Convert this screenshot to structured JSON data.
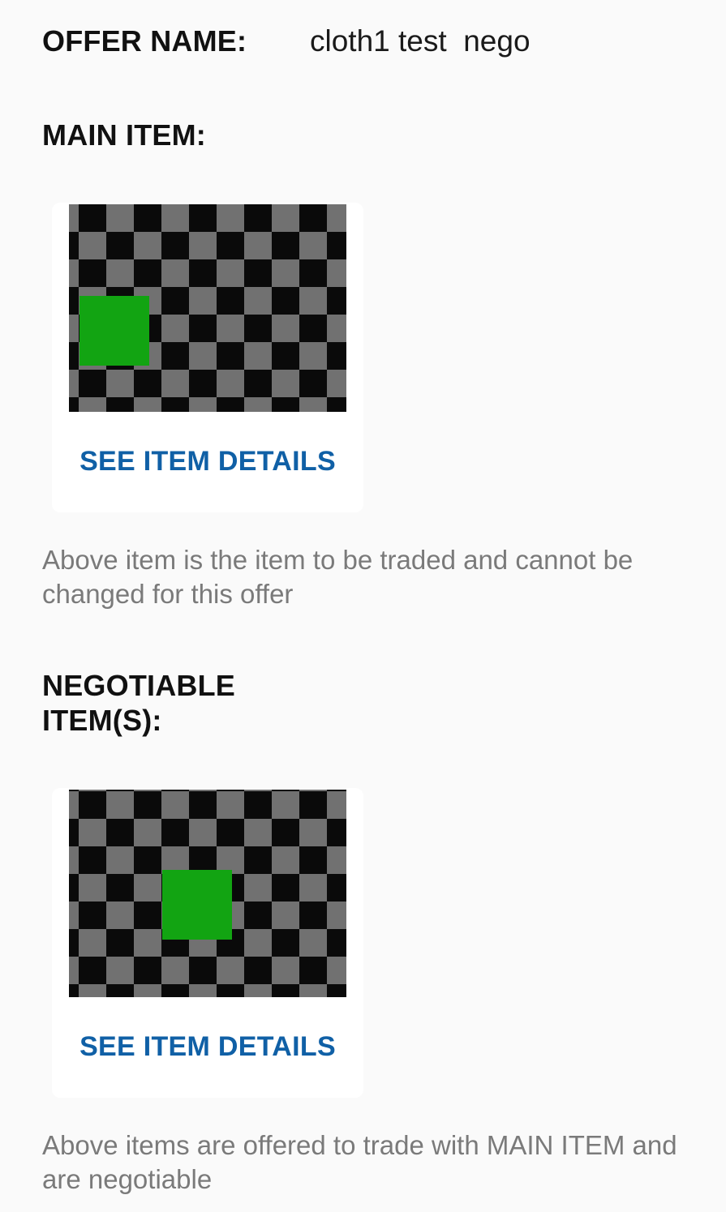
{
  "offer": {
    "name_label": "OFFER NAME:",
    "name_value": "cloth1 test  nego"
  },
  "main_item": {
    "section_label": "MAIN ITEM:",
    "details_button": "SEE ITEM DETAILS",
    "note": "Above item is the item to be traded and cannot be changed for this offer"
  },
  "negotiable_items": {
    "section_label": "NEGOTIABLE ITEM(S):",
    "details_button": "SEE ITEM DETAILS",
    "note": "Above items are offered to trade with MAIN ITEM and are negotiable"
  },
  "colors": {
    "background": "#fafafa",
    "card": "#ffffff",
    "link": "#1060a6",
    "hint_text": "#7a7a7a",
    "item_green": "#12a412",
    "checker_dark": "#0a0a0a",
    "checker_light": "#717171"
  }
}
